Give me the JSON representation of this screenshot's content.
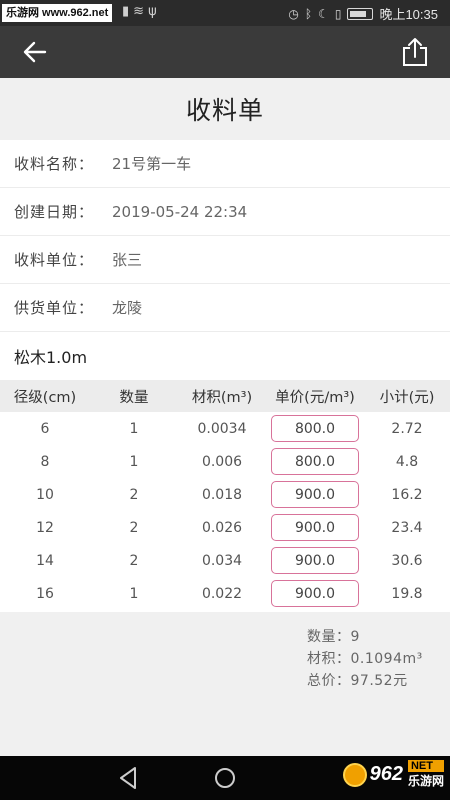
{
  "statusbar": {
    "watermark": "乐游网 www.962.net",
    "time": "晚上10:35",
    "icons_left": [
      "signal-icon",
      "wifi-icon",
      "usb-icon"
    ],
    "icons_right": [
      "alarm-icon",
      "bluetooth-icon",
      "moon-icon",
      "vibrate-icon",
      "battery-icon"
    ]
  },
  "appbar": {
    "back_icon": "arrow-left-icon",
    "share_icon": "share-icon"
  },
  "page": {
    "title": "收料单"
  },
  "form": {
    "name_label": "收料名称：",
    "name_value": "21号第一车",
    "date_label": "创建日期：",
    "date_value": "2019-05-24 22:34",
    "receiver_label": "收料单位：",
    "receiver_value": "张三",
    "supplier_label": "供货单位：",
    "supplier_value": "龙陵"
  },
  "species": "松木1.0m",
  "table": {
    "headers": [
      "径级(cm)",
      "数量",
      "材积(m³)",
      "单价(元/m³)",
      "小计(元)"
    ],
    "rows": [
      {
        "diameter": "6",
        "qty": "1",
        "volume": "0.0034",
        "price": "800.0",
        "subtotal": "2.72"
      },
      {
        "diameter": "8",
        "qty": "1",
        "volume": "0.006",
        "price": "800.0",
        "subtotal": "4.8"
      },
      {
        "diameter": "10",
        "qty": "2",
        "volume": "0.018",
        "price": "900.0",
        "subtotal": "16.2"
      },
      {
        "diameter": "12",
        "qty": "2",
        "volume": "0.026",
        "price": "900.0",
        "subtotal": "23.4"
      },
      {
        "diameter": "14",
        "qty": "2",
        "volume": "0.034",
        "price": "900.0",
        "subtotal": "30.6"
      },
      {
        "diameter": "16",
        "qty": "1",
        "volume": "0.022",
        "price": "900.0",
        "subtotal": "19.8"
      }
    ]
  },
  "summary": {
    "count": "数量：9",
    "volume": "材积：0.1094m³",
    "total": "总价：97.52元"
  },
  "navbar": {
    "logo_digits": "962",
    "logo_net": "NET",
    "logo_cn": "乐游网"
  },
  "colors": {
    "price_border": "#d8739a",
    "appbar_bg": "#3a3a3a",
    "statusbar_bg": "#2b2b2b"
  }
}
